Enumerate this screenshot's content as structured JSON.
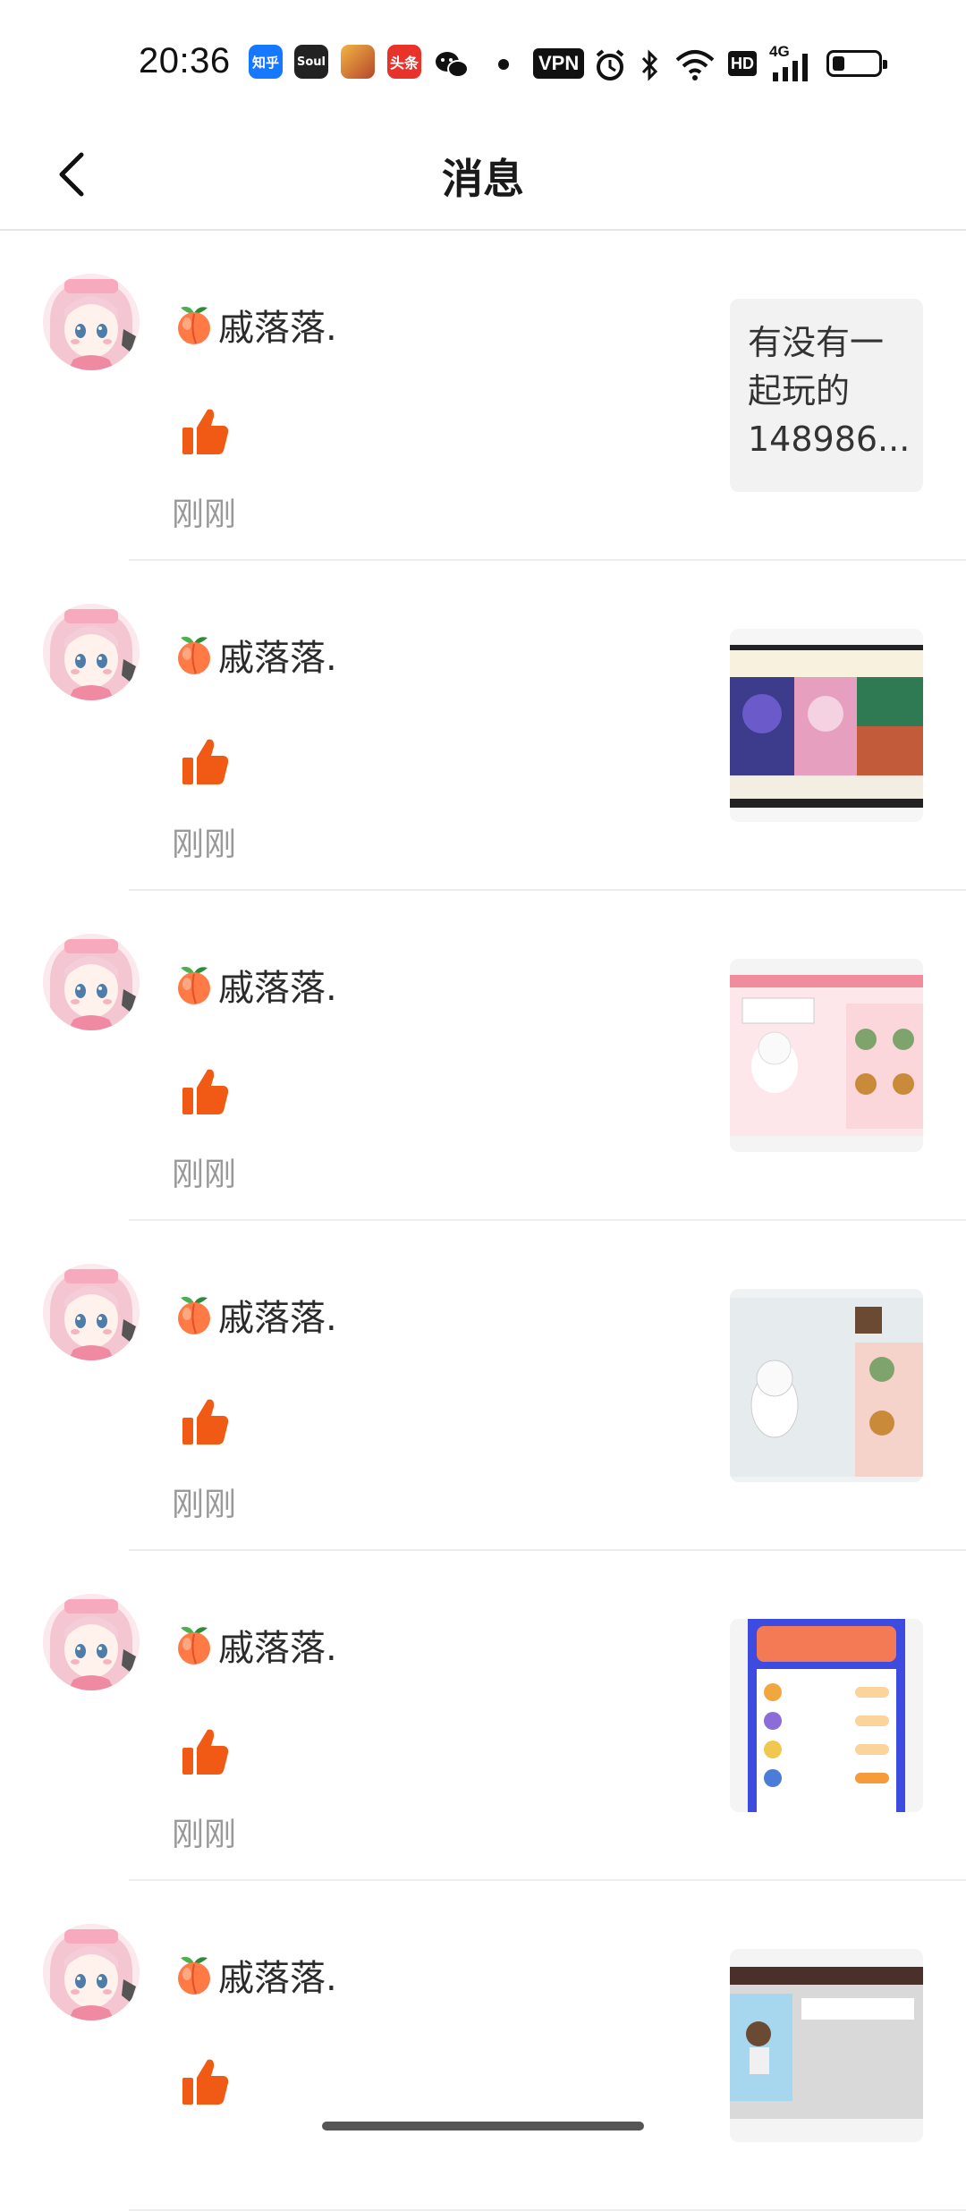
{
  "status_bar": {
    "time": "20:36",
    "app_icons": [
      "zhihu-icon",
      "soul-icon",
      "game-icon",
      "toutiao-icon",
      "wechat-icon"
    ],
    "zhihu_label": "知乎",
    "soul_label": "Soul",
    "toutiao_label": "头条",
    "vpn_label": "VPN",
    "hd_label": "HD",
    "network_label": "4G",
    "battery_level": 0.25
  },
  "header": {
    "title": "消息",
    "back_icon": "chevron-left-icon"
  },
  "messages": [
    {
      "name": "戚落落.",
      "time": "刚刚",
      "thumb_type": "text",
      "thumb_lines": [
        "有没有一",
        "起玩的",
        "148986..."
      ]
    },
    {
      "name": "戚落落.",
      "time": "刚刚",
      "thumb_type": "image",
      "thumb_theme": "game-lobby"
    },
    {
      "name": "戚落落.",
      "time": "刚刚",
      "thumb_type": "image",
      "thumb_theme": "character-pink"
    },
    {
      "name": "戚落落.",
      "time": "刚刚",
      "thumb_type": "image",
      "thumb_theme": "character-profile"
    },
    {
      "name": "戚落落.",
      "time": "刚刚",
      "thumb_type": "image",
      "thumb_theme": "signin-rewards"
    },
    {
      "name": "戚落落.",
      "time": "",
      "thumb_type": "image",
      "thumb_theme": "room-scene"
    }
  ],
  "colors": {
    "like": "#f05a14",
    "divider": "#ededed",
    "time_gray": "#999999"
  }
}
